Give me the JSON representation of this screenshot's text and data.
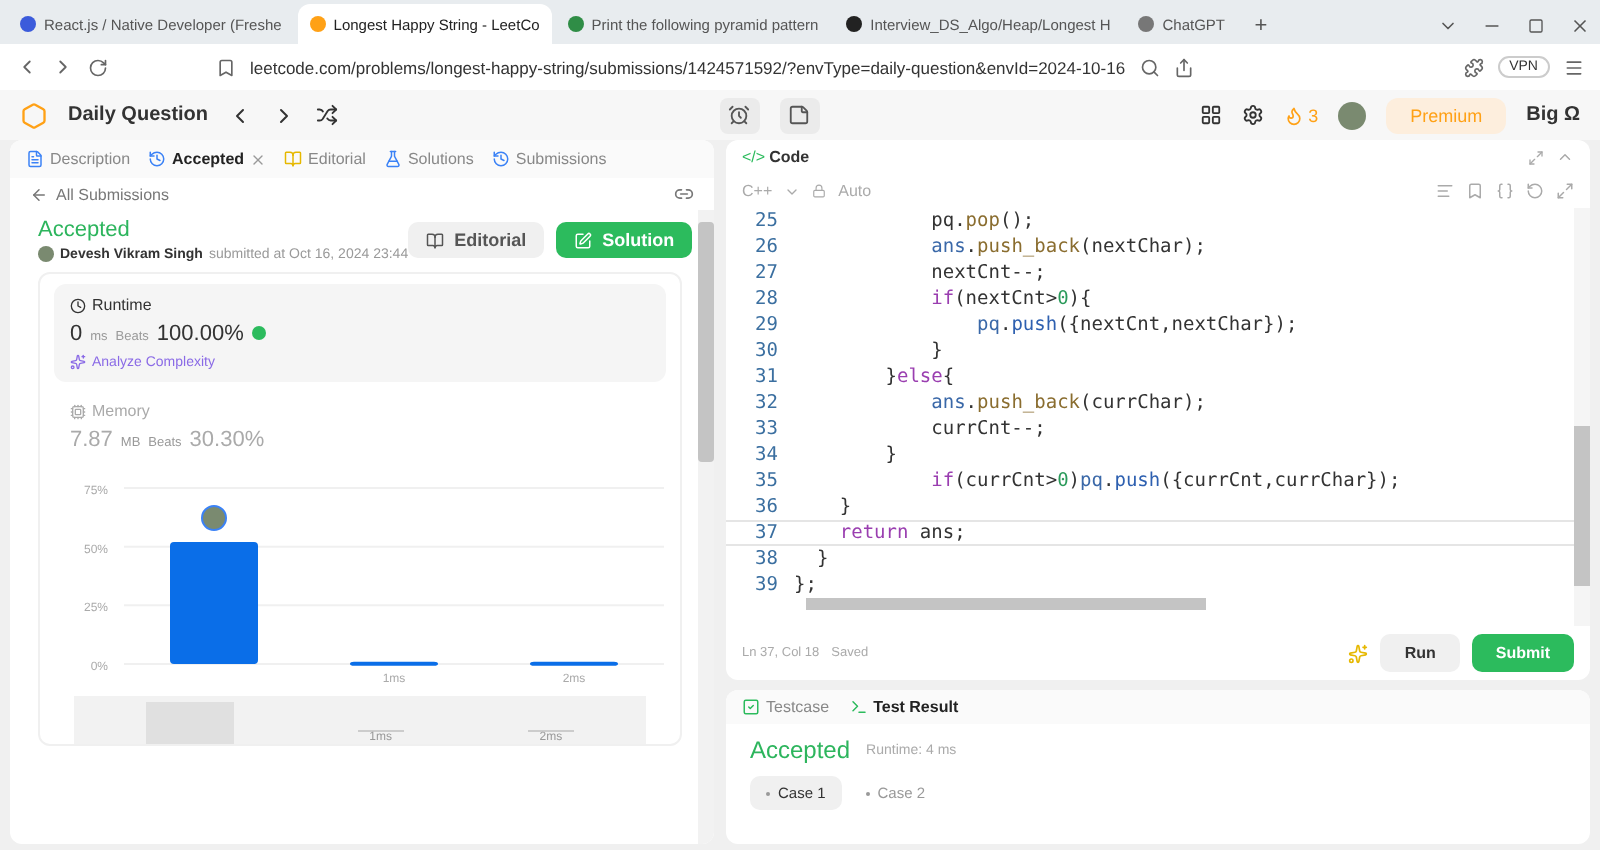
{
  "browser": {
    "tabs": [
      {
        "title": "React.js / Native Developer (Freshe",
        "selected": false
      },
      {
        "title": "Longest Happy String - LeetCo",
        "selected": true
      },
      {
        "title": "Print the following pyramid pattern",
        "selected": false
      },
      {
        "title": "Interview_DS_Algo/Heap/Longest H",
        "selected": false
      },
      {
        "title": "ChatGPT",
        "selected": false
      }
    ],
    "new_tab": "+",
    "url": "leetcode.com/problems/longest-happy-string/submissions/1424571592/?envType=daily-question&envId=2024-10-16",
    "vpn": "VPN"
  },
  "nav": {
    "title": "Daily Question",
    "streak": "3",
    "premium": "Premium",
    "user": "Big Ω"
  },
  "left": {
    "tabs": [
      {
        "label": "Description",
        "selected": false
      },
      {
        "label": "Accepted",
        "selected": true,
        "closable": true
      },
      {
        "label": "Editorial",
        "selected": false
      },
      {
        "label": "Solutions",
        "selected": false
      },
      {
        "label": "Submissions",
        "selected": false
      }
    ],
    "back": "All Submissions",
    "status": "Accepted",
    "author": "Devesh Vikram Singh",
    "submitted": "submitted at Oct 16, 2024 23:44",
    "buttons": [
      {
        "label": "Editorial",
        "kind": "secondary"
      },
      {
        "label": "Solution",
        "kind": "primary"
      }
    ],
    "runtime": {
      "title": "Runtime",
      "value": "0",
      "unit": "ms",
      "beats_label": "Beats",
      "beats": "100.00%",
      "analyze": "Analyze Complexity"
    },
    "memory": {
      "title": "Memory",
      "value": "7.87",
      "unit": "MB",
      "beats_label": "Beats",
      "beats": "30.30%"
    },
    "chart_data": {
      "type": "bar",
      "categories": [
        null,
        "1ms",
        "2ms"
      ],
      "values": [
        52,
        1,
        1
      ],
      "ylim": [
        0,
        75
      ],
      "yticks": [
        {
          "value": 0,
          "label": "0%"
        },
        {
          "value": 25,
          "label": "25%"
        },
        {
          "value": 50,
          "label": "50%"
        },
        {
          "value": 75,
          "label": "75%"
        }
      ]
    },
    "range_labels": [
      "1ms",
      "2ms"
    ]
  },
  "code": {
    "icon": "</>",
    "title": "Code",
    "language": "C++",
    "mode": "Auto",
    "lines": [
      {
        "n": "25",
        "tokens": [
          {
            "t": "            pq.",
            "kind": "plain"
          },
          {
            "t": "pop",
            "kind": "fn"
          },
          {
            "t": "();",
            "kind": "plain"
          }
        ]
      },
      {
        "n": "26",
        "tokens": [
          {
            "t": "            ans",
            "kind": "var"
          },
          {
            "t": ".",
            "kind": "plain"
          },
          {
            "t": "push_back",
            "kind": "fn"
          },
          {
            "t": "(nextChar);",
            "kind": "plain"
          }
        ]
      },
      {
        "n": "27",
        "tokens": [
          {
            "t": "            nextCnt--;",
            "kind": "plain"
          }
        ]
      },
      {
        "n": "28",
        "tokens": [
          {
            "t": "            if",
            "kind": "kw"
          },
          {
            "t": "(nextCnt>",
            "kind": "plain"
          },
          {
            "t": "0",
            "kind": "num"
          },
          {
            "t": "){",
            "kind": "plain"
          }
        ]
      },
      {
        "n": "29",
        "tokens": [
          {
            "t": "                pq",
            "kind": "var"
          },
          {
            "t": ".",
            "kind": "plain"
          },
          {
            "t": "push",
            "kind": "fn2"
          },
          {
            "t": "({nextCnt,nextChar});",
            "kind": "plain"
          }
        ]
      },
      {
        "n": "30",
        "tokens": [
          {
            "t": "            }",
            "kind": "plain"
          }
        ]
      },
      {
        "n": "31",
        "tokens": [
          {
            "t": "        }",
            "kind": "plain"
          },
          {
            "t": "else",
            "kind": "kw"
          },
          {
            "t": "{",
            "kind": "plain"
          }
        ]
      },
      {
        "n": "32",
        "tokens": [
          {
            "t": "            ans",
            "kind": "var"
          },
          {
            "t": ".",
            "kind": "plain"
          },
          {
            "t": "push_back",
            "kind": "fn"
          },
          {
            "t": "(currChar);",
            "kind": "plain"
          }
        ]
      },
      {
        "n": "33",
        "tokens": [
          {
            "t": "            currCnt--;",
            "kind": "plain"
          }
        ]
      },
      {
        "n": "34",
        "tokens": [
          {
            "t": "        }",
            "kind": "plain"
          }
        ]
      },
      {
        "n": "35",
        "tokens": [
          {
            "t": "            if",
            "kind": "kw"
          },
          {
            "t": "(currCnt>",
            "kind": "plain"
          },
          {
            "t": "0",
            "kind": "num"
          },
          {
            "t": ")",
            "kind": "plain"
          },
          {
            "t": "pq",
            "kind": "var"
          },
          {
            "t": ".",
            "kind": "plain"
          },
          {
            "t": "push",
            "kind": "fn2"
          },
          {
            "t": "({currCnt,currChar});",
            "kind": "plain"
          }
        ]
      },
      {
        "n": "36",
        "tokens": [
          {
            "t": "    }",
            "kind": "plain"
          }
        ]
      },
      {
        "n": "37",
        "tokens": [
          {
            "t": "    return",
            "kind": "kw"
          },
          {
            "t": " ans;",
            "kind": "plain"
          }
        ],
        "current": true
      },
      {
        "n": "38",
        "tokens": [
          {
            "t": "  }",
            "kind": "plain"
          }
        ]
      },
      {
        "n": "39",
        "tokens": [
          {
            "t": "};",
            "kind": "plain"
          }
        ]
      }
    ],
    "position": "Ln 37, Col 18",
    "saved": "Saved",
    "run": "Run",
    "submit": "Submit"
  },
  "result": {
    "tabs": [
      {
        "label": "Testcase",
        "selected": false
      },
      {
        "label": "Test Result",
        "selected": true
      }
    ],
    "status": "Accepted",
    "runtime": "Runtime: 4 ms",
    "cases": [
      {
        "label": "Case 1",
        "selected": true
      },
      {
        "label": "Case 2",
        "selected": false
      }
    ]
  }
}
